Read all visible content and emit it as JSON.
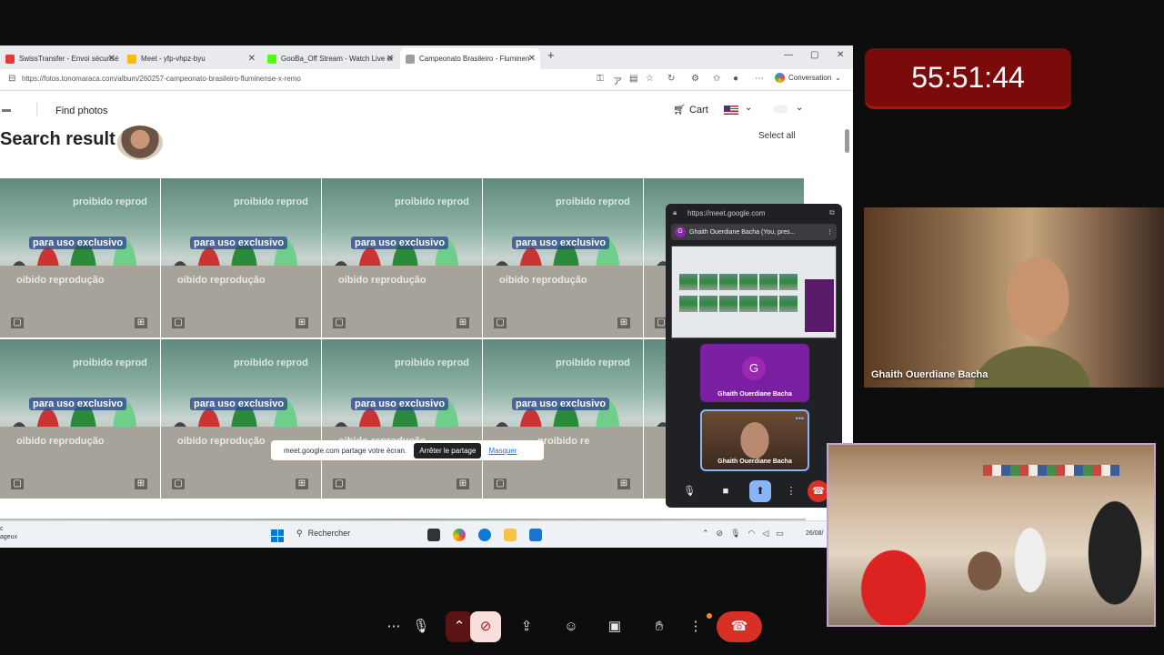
{
  "browser": {
    "tabs": [
      {
        "label": "SwissTransfer - Envoi sécurisé et g",
        "fav_color": "#e53935"
      },
      {
        "label": "Meet - yfp-vhpz-byu",
        "fav_color": "#fbbc05"
      },
      {
        "label": "GooBa_Off Stream - Watch Live or",
        "fav_color": "#53fc18"
      },
      {
        "label": "Campeonato Brasileiro - Fluminen",
        "fav_color": "#9e9e9e"
      }
    ],
    "new_tab": "+",
    "url": "https://fotos.tonomaraca.com/album/260257-campeonato-brasileiro-fluminense-x-remo",
    "conversation": "Conversation"
  },
  "site": {
    "find_photos": "Find photos",
    "cart": "Cart",
    "search_result": "Search result",
    "select_all": "Select all"
  },
  "photo": {
    "badge": "para uso exclusivo",
    "wm_top": "proibido reprod",
    "wm_mid": "oibido reprodução",
    "wm_bottom": "proibido re"
  },
  "share_banner": {
    "text": "meet.google.com partage votre écran.",
    "stop": "Arrêter le partage",
    "hide": "Masquer"
  },
  "taskbar": {
    "left_line1": "c",
    "left_line2": "ageux",
    "search": "Rechercher",
    "date": "26/08/"
  },
  "meet_pip": {
    "url": "https://meet.google.com",
    "header": "Ghaith Ouerdiane Bacha (You, pres...",
    "avatar_letter": "G",
    "name": "Ghaith Ouerdiane Bacha"
  },
  "clock": "55:51:44",
  "participant": {
    "name": "Ghaith Ouerdiane Bacha"
  }
}
